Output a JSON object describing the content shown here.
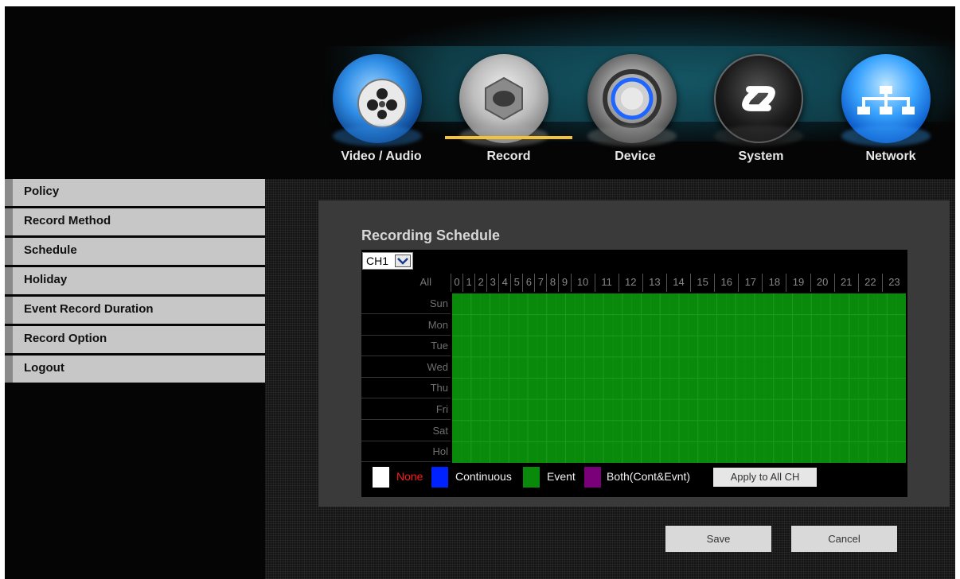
{
  "colors": {
    "accent": "#f2c23a",
    "sidebar_bg": "#c7c7c7",
    "panel_bg": "#3a3a3a",
    "event_green": "#0a8a0a",
    "none_red": "#ff1a1a",
    "continuous_blue": "#0022ff",
    "both_purple": "#7a007a"
  },
  "topnav": {
    "active": "Record",
    "items": [
      {
        "label": "Video / Audio",
        "icon": "video-audio-icon"
      },
      {
        "label": "Record",
        "icon": "record-icon"
      },
      {
        "label": "Device",
        "icon": "device-icon"
      },
      {
        "label": "System",
        "icon": "system-icon"
      },
      {
        "label": "Network",
        "icon": "network-icon"
      }
    ]
  },
  "sidebar": {
    "items": [
      {
        "label": "Policy"
      },
      {
        "label": "Record Method"
      },
      {
        "label": "Schedule"
      },
      {
        "label": "Holiday"
      },
      {
        "label": "Event Record Duration"
      },
      {
        "label": "Record Option"
      },
      {
        "label": "Logout"
      }
    ]
  },
  "schedule": {
    "title": "Recording Schedule",
    "channel": "CH1",
    "all_label": "All",
    "hours": [
      "0",
      "1",
      "2",
      "3",
      "4",
      "5",
      "6",
      "7",
      "8",
      "9",
      "10",
      "11",
      "12",
      "13",
      "14",
      "15",
      "16",
      "17",
      "18",
      "19",
      "20",
      "21",
      "22",
      "23"
    ],
    "days": [
      "Sun",
      "Mon",
      "Tue",
      "Wed",
      "Thu",
      "Fri",
      "Sat",
      "Hol"
    ],
    "fill_mode": "Event"
  },
  "legend": {
    "none": "None",
    "continuous": "Continuous",
    "event": "Event",
    "both": "Both(Cont&Evnt)",
    "apply_all": "Apply to All CH"
  },
  "actions": {
    "save": "Save",
    "cancel": "Cancel"
  }
}
